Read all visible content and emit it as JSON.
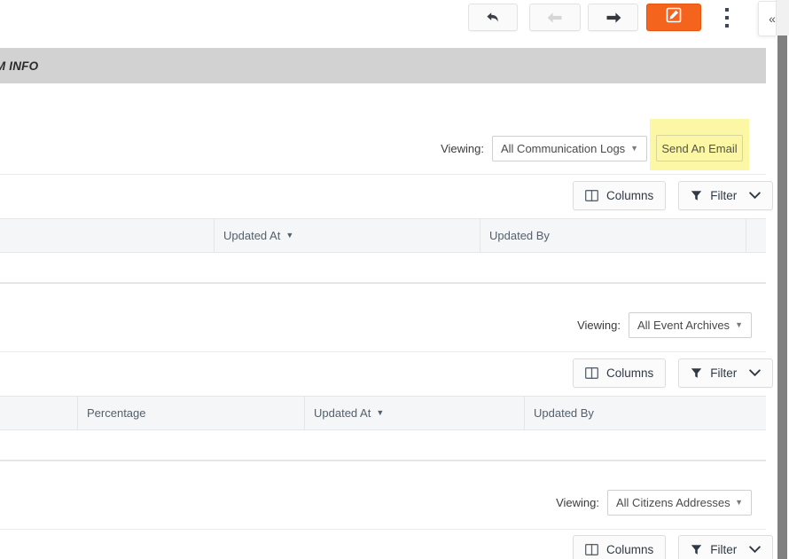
{
  "toolbar": {
    "undo_label": "undo-arrow",
    "back_label": "back-arrow",
    "forward_label": "forward-arrow",
    "edit_label": "edit",
    "kebab_label": "more-options",
    "collapse_label": "«"
  },
  "section": {
    "title": "STEM INFO"
  },
  "panels": [
    {
      "viewing_label": "Viewing:",
      "viewing_value": "All Communication Logs",
      "caret": "▼",
      "action_button": "Send An Email",
      "columns_label": "Columns",
      "filter_label": "Filter",
      "chevron": "▾",
      "headers": [
        "",
        "Updated At",
        "Updated By",
        ""
      ],
      "sort_indicator": "▼",
      "sorted_column_index": 1
    },
    {
      "viewing_label": "Viewing:",
      "viewing_value": "All Event Archives",
      "caret": "▼",
      "columns_label": "Columns",
      "filter_label": "Filter",
      "chevron": "▾",
      "headers": [
        "",
        "Percentage",
        "Updated At",
        "Updated By"
      ],
      "sort_indicator": "▼",
      "sorted_column_index": 2
    },
    {
      "viewing_label": "Viewing:",
      "viewing_value": "All Citizens Addresses",
      "caret": "▼",
      "columns_label": "Columns",
      "filter_label": "Filter",
      "chevron": "▾"
    }
  ],
  "colors": {
    "accent_orange": "#f4641d",
    "banner_gray": "#d2d2d2",
    "highlight_yellow": "#fbf7a5",
    "grid_header": "#f4f6f8",
    "scrollbar": "#808080"
  }
}
